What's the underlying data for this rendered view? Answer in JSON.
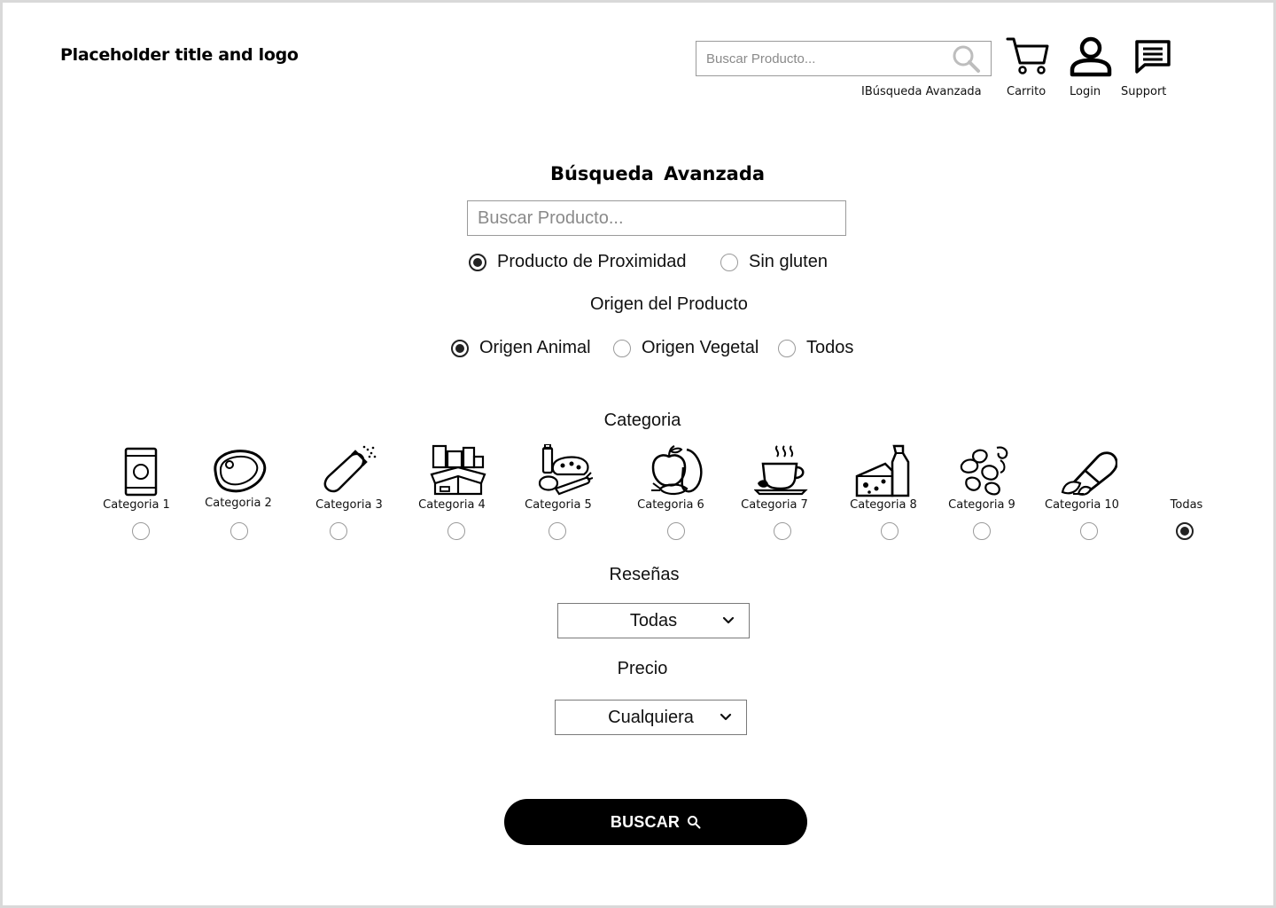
{
  "header": {
    "logo_text": "Placeholder title and logo",
    "search_placeholder": "Buscar Producto...",
    "search_icon": "search-icon",
    "nav": [
      {
        "label": "IBúsqueda Avanzada",
        "icon": "search-icon"
      },
      {
        "label": "Carrito",
        "icon": "cart-icon"
      },
      {
        "label": "Login",
        "icon": "user-icon"
      },
      {
        "label": "Support",
        "icon": "chat-icon"
      }
    ]
  },
  "main": {
    "title": "Búsqueda  Avanzada",
    "search_placeholder": "Buscar Producto...",
    "filters": [
      {
        "label": "Producto de Proximidad",
        "checked": true
      },
      {
        "label": "Sin gluten",
        "checked": false
      }
    ],
    "origin": {
      "heading": "Origen del Producto",
      "options": [
        {
          "label": "Origen Animal",
          "checked": true
        },
        {
          "label": "Origen Vegetal",
          "checked": false
        },
        {
          "label": "Todos",
          "checked": false
        }
      ]
    },
    "category": {
      "heading": "Categoria",
      "items": [
        {
          "label": "Categoria 1",
          "icon": "can-icon",
          "checked": false
        },
        {
          "label": "Categoria 2",
          "icon": "steak-icon",
          "checked": false
        },
        {
          "label": "Categoria 3",
          "icon": "salt-shaker-icon",
          "checked": false
        },
        {
          "label": "Categoria 4",
          "icon": "pantry-box-icon",
          "checked": false
        },
        {
          "label": "Categoria 5",
          "icon": "groceries-icon",
          "checked": false
        },
        {
          "label": "Categoria 6",
          "icon": "fruits-vegetables-icon",
          "checked": false
        },
        {
          "label": "Categoria 7",
          "icon": "coffee-cup-icon",
          "checked": false
        },
        {
          "label": "Categoria 8",
          "icon": "dairy-cheese-icon",
          "checked": false
        },
        {
          "label": "Categoria 9",
          "icon": "beans-icon",
          "checked": false
        },
        {
          "label": "Categoria 10",
          "icon": "vegan-pill-icon",
          "checked": false
        },
        {
          "label": "Todas",
          "icon": "",
          "checked": true
        }
      ]
    },
    "reviews": {
      "heading": "Reseñas",
      "selected": "Todas",
      "icon": "chevron-down-icon"
    },
    "price": {
      "heading": "Precio",
      "selected": "Cualquiera",
      "icon": "chevron-down-icon"
    },
    "submit": {
      "label": "BUSCAR",
      "icon": "search-icon"
    }
  }
}
